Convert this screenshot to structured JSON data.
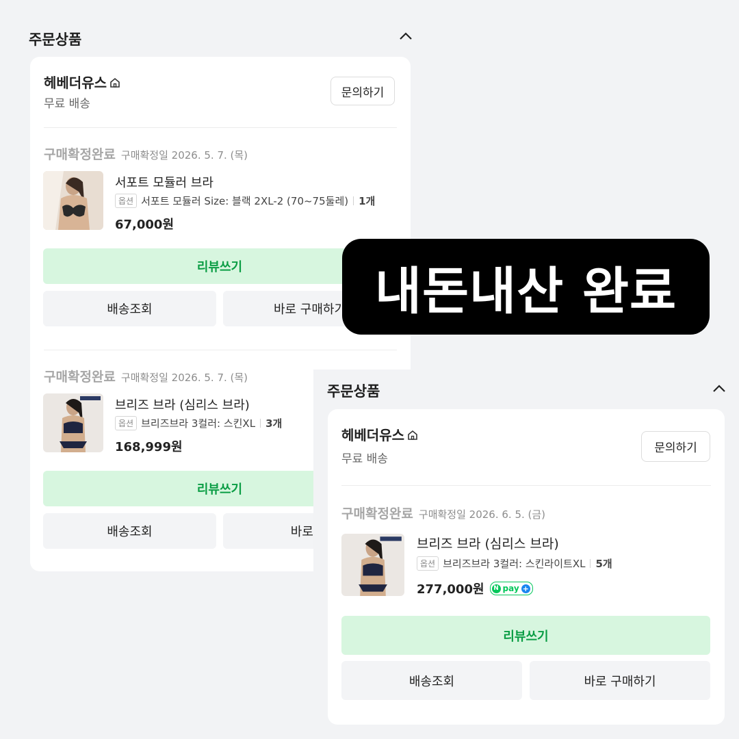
{
  "order_a": {
    "section_title": "주문상품",
    "seller": "헤베더유스",
    "shipping": "무료 배송",
    "inquiry_label": "문의하기",
    "items": [
      {
        "status": "구매확정완료",
        "confirm_date": "구매확정일 2026. 5. 7. (목)",
        "name": "서포트 모듈러 브라",
        "option_tag": "옵션",
        "option": "서포트 모듈러 Size: 블랙 2XL-2 (70~75둘레)",
        "qty": "1개",
        "price": "67,000원",
        "review_label": "리뷰쓰기",
        "track_label": "배송조회",
        "buy_label": "바로 구매하기"
      },
      {
        "status": "구매확정완료",
        "confirm_date": "구매확정일 2026. 5. 7. (목)",
        "name": "브리즈 브라 (심리스 브라)",
        "option_tag": "옵션",
        "option": "브리즈브라 3컬러: 스킨XL",
        "qty": "3개",
        "price": "168,999원",
        "review_label": "리뷰쓰기",
        "track_label": "배송조회",
        "buy_label": "바로 구"
      }
    ]
  },
  "overlay_text": "내돈내산 완료",
  "order_b": {
    "section_title": "주문상품",
    "seller": "헤베더유스",
    "shipping": "무료 배송",
    "inquiry_label": "문의하기",
    "item": {
      "status": "구매확정완료",
      "confirm_date": "구매확정일 2026. 6. 5. (금)",
      "name": "브리즈 브라 (심리스 브라)",
      "option_tag": "옵션",
      "option": "브리즈브라 3컬러: 스킨라이트XL",
      "qty": "5개",
      "price": "277,000원",
      "npay_label": "pay",
      "review_label": "리뷰쓰기",
      "track_label": "배송조회",
      "buy_label": "바로 구매하기"
    }
  },
  "colors": {
    "green": "#0a9d44",
    "green_bg": "#d7f6df",
    "status_gray": "#a6a6a6",
    "npay_blue": "#1a86f0"
  },
  "icons": [
    "chevron-up-icon",
    "home-icon",
    "npay-icon"
  ]
}
